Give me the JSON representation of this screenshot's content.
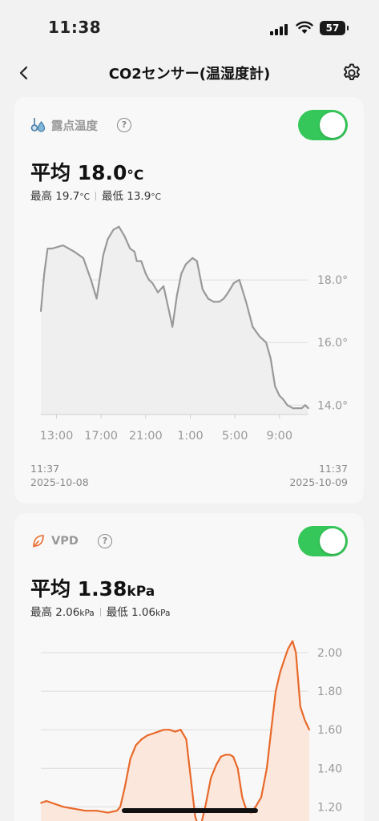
{
  "status_bar": {
    "time": "11:38",
    "battery": "57"
  },
  "nav": {
    "title": "CO2センサー(温湿度計)",
    "back_icon": "chevron-left-icon",
    "settings_icon": "gear-icon"
  },
  "cards": [
    {
      "label": "露点温度",
      "icon": "dewpoint-icon",
      "enabled": true,
      "average_prefix": "平均 ",
      "average_value": "18.0",
      "average_unit": "°C",
      "max_label": "最高 ",
      "max_value": "19.7",
      "min_label": "最低 ",
      "min_value": "13.9",
      "unit": "°C",
      "range_start": {
        "time": "11:37",
        "date": "2025-10-08"
      },
      "range_end": {
        "time": "11:37",
        "date": "2025-10-09"
      },
      "line_color": "#999999",
      "fill_color": "#efefef"
    },
    {
      "label": "VPD",
      "icon": "leaf-icon",
      "enabled": true,
      "average_prefix": "平均 ",
      "average_value": "1.38",
      "average_unit": "kPa",
      "max_label": "最高 ",
      "max_value": "2.06",
      "min_label": "最低 ",
      "min_value": "1.06",
      "unit": "kPa",
      "line_color": "#e8692a",
      "fill_color": "#fbe7dc"
    }
  ],
  "chart_data": [
    {
      "type": "line",
      "y_unit": "°C",
      "y_ticks": [
        "14.0°",
        "16.0°",
        "18.0°"
      ],
      "y_tick_values": [
        14.0,
        16.0,
        18.0
      ],
      "ylim": [
        13.7,
        20.0
      ],
      "x_ticks": [
        "13:00",
        "17:00",
        "21:00",
        "1:00",
        "5:00",
        "9:00"
      ],
      "x_tick_hours": [
        1.4,
        5.4,
        9.4,
        13.4,
        17.4,
        21.4
      ],
      "xlim": [
        0,
        24
      ],
      "grid": true,
      "x_hours": [
        0,
        0.3,
        0.6,
        1.0,
        2.0,
        3.0,
        3.8,
        4.5,
        5.0,
        5.6,
        6.0,
        6.5,
        7.0,
        7.5,
        8.0,
        8.4,
        8.6,
        9.0,
        9.4,
        9.7,
        10.0,
        10.5,
        11.0,
        11.5,
        11.8,
        12.2,
        12.6,
        13.0,
        13.3,
        13.6,
        14.0,
        14.5,
        15.0,
        15.5,
        16.0,
        16.4,
        16.8,
        17.3,
        17.8,
        18.4,
        19.0,
        19.6,
        20.2,
        20.6,
        21.0,
        21.4,
        21.7,
        22.1,
        22.6,
        23.0,
        23.4,
        23.7,
        24.0
      ],
      "values": [
        17.0,
        18.2,
        19.0,
        19.0,
        19.1,
        18.9,
        18.7,
        18.0,
        17.4,
        18.8,
        19.3,
        19.6,
        19.7,
        19.4,
        19.0,
        18.9,
        18.6,
        18.6,
        18.2,
        18.0,
        17.9,
        17.6,
        17.8,
        17.0,
        16.5,
        17.5,
        18.2,
        18.5,
        18.6,
        18.7,
        18.6,
        17.7,
        17.4,
        17.3,
        17.3,
        17.4,
        17.6,
        17.9,
        18.0,
        17.3,
        16.5,
        16.2,
        16.0,
        15.5,
        14.6,
        14.3,
        14.2,
        14.0,
        13.9,
        13.9,
        13.9,
        14.0,
        13.9
      ]
    },
    {
      "type": "area",
      "y_unit": "kPa",
      "y_ticks": [
        "1.20",
        "1.40",
        "1.60",
        "1.80",
        "2.00"
      ],
      "y_tick_values": [
        1.2,
        1.4,
        1.6,
        1.8,
        2.0
      ],
      "ylim": [
        1.06,
        2.1
      ],
      "xlim": [
        0,
        24
      ],
      "grid": true,
      "x_hours": [
        0,
        0.5,
        1.0,
        2.0,
        3.0,
        4.0,
        5.0,
        6.0,
        6.8,
        7.1,
        7.5,
        8.0,
        8.5,
        9.0,
        9.5,
        10.0,
        10.5,
        11.0,
        11.5,
        12.0,
        12.5,
        13.0,
        13.5,
        13.8,
        14.2,
        14.7,
        15.2,
        15.7,
        16.1,
        16.5,
        16.9,
        17.2,
        17.6,
        18.0,
        18.4,
        18.8,
        19.2,
        19.7,
        20.2,
        20.6,
        21.0,
        21.4,
        21.8,
        22.1,
        22.5,
        22.8,
        23.2,
        23.6,
        24.0
      ],
      "values": [
        1.22,
        1.23,
        1.22,
        1.2,
        1.19,
        1.18,
        1.18,
        1.17,
        1.18,
        1.2,
        1.3,
        1.45,
        1.52,
        1.55,
        1.57,
        1.58,
        1.59,
        1.6,
        1.6,
        1.59,
        1.6,
        1.55,
        1.3,
        1.15,
        1.08,
        1.2,
        1.35,
        1.42,
        1.46,
        1.47,
        1.47,
        1.46,
        1.4,
        1.25,
        1.18,
        1.17,
        1.2,
        1.25,
        1.4,
        1.6,
        1.8,
        1.9,
        1.97,
        2.02,
        2.06,
        2.0,
        1.72,
        1.65,
        1.6
      ]
    }
  ]
}
